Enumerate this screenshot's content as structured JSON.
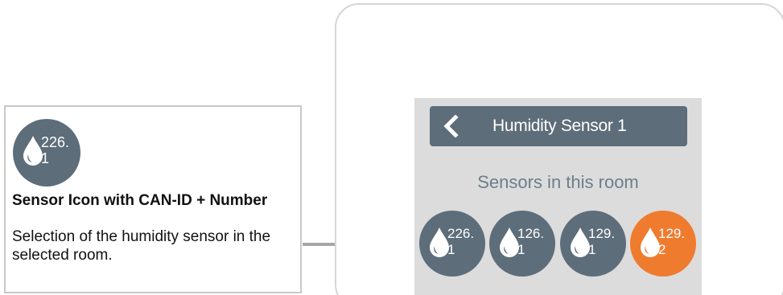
{
  "callout": {
    "icon": {
      "name": "water-drop-icon",
      "id_top": "226.",
      "id_bottom": "1"
    },
    "title": "Sensor Icon with CAN-ID + Number",
    "description": "Selection of the humidity sensor in the selected room."
  },
  "screen": {
    "header": {
      "back_icon": "chevron-left-icon",
      "title": "Humidity Sensor 1"
    },
    "section_title": "Sensors in this room",
    "sensors": [
      {
        "id_top": "226.",
        "id_bottom": "1",
        "icon": "water-drop-icon",
        "active": false
      },
      {
        "id_top": "126.",
        "id_bottom": "1",
        "icon": "water-drop-icon",
        "active": false
      },
      {
        "id_top": "129.",
        "id_bottom": "1",
        "icon": "water-drop-icon",
        "active": false
      },
      {
        "id_top": "129.",
        "id_bottom": "2",
        "icon": "water-drop-icon",
        "active": true
      }
    ]
  },
  "colors": {
    "sensor_default": "#5d6d7a",
    "sensor_active": "#ef7b2f",
    "header_bar": "#5d6d7a",
    "screen_background": "#dcdcdc",
    "section_title": "#6d7e8a",
    "arrow": "#a6a6a6"
  }
}
